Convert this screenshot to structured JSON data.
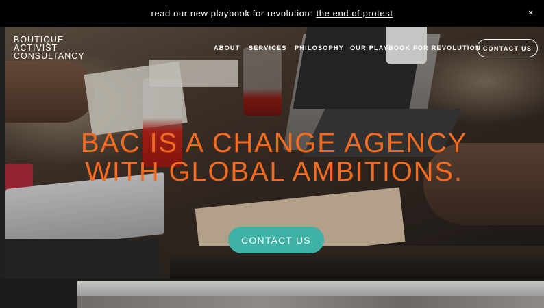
{
  "announcement": {
    "text": "read our new playbook for revolution:",
    "link": "the end of protest",
    "close_icon": "×"
  },
  "brand": {
    "line1": "BOUTIQUE",
    "line2": "ACTIVIST",
    "line3": "CONSULTANCY"
  },
  "nav": {
    "about": "ABOUT",
    "services": "SERVICES",
    "philosophy": "PHILOSOPHY",
    "playbook": "OUR PLAYBOOK FOR REVOLUTION",
    "contact": "CONTACT US"
  },
  "hero": {
    "headline": "BAC IS A CHANGE AGENCY WITH GLOBAL AMBITIONS.",
    "button": "CONTACT US"
  },
  "colors": {
    "headline": "#f26b21",
    "button": "#3fb2a7",
    "announce_bg": "#000000"
  }
}
